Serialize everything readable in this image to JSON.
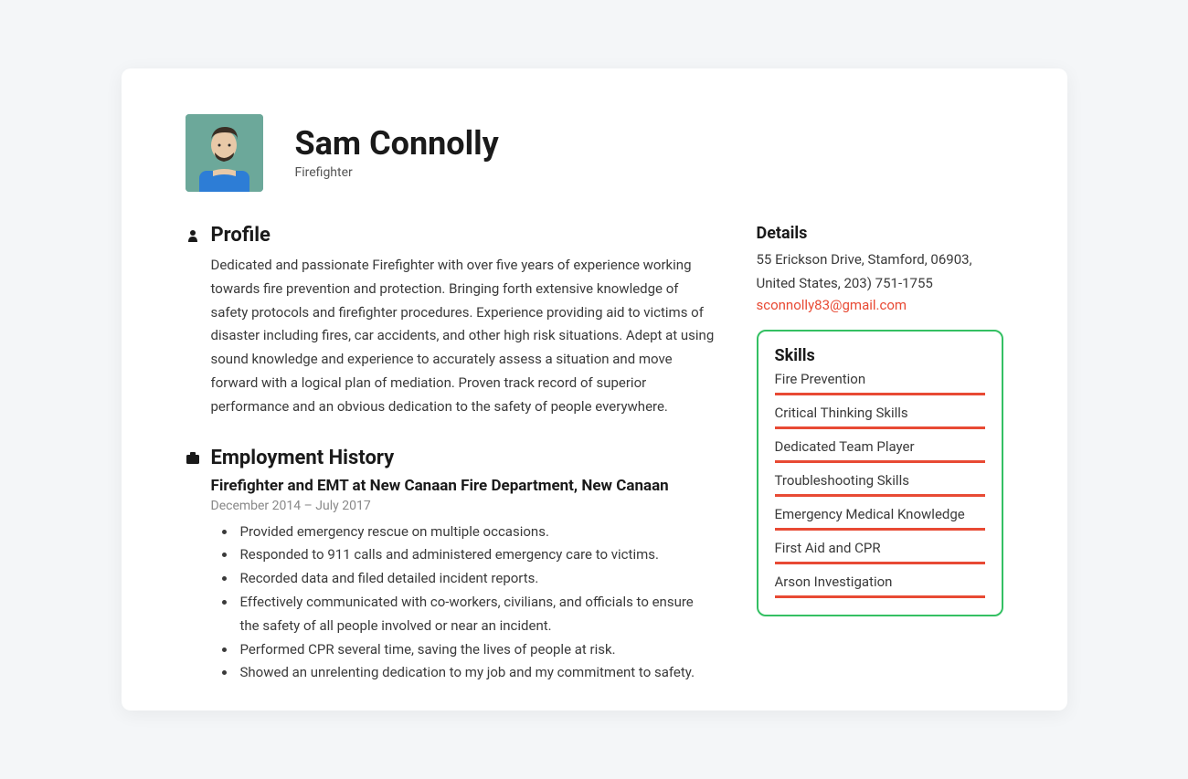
{
  "header": {
    "name": "Sam Connolly",
    "title": "Firefighter"
  },
  "profile": {
    "heading": "Profile",
    "text": "Dedicated and passionate Firefighter with over five years of experience working towards fire prevention and protection. Bringing forth extensive knowledge of safety protocols and firefighter procedures. Experience providing aid to victims of disaster including fires, car accidents, and other high risk situations. Adept at using sound knowledge and experience to accurately assess a situation and move forward with a logical plan of mediation. Proven track record of superior performance and an obvious dedication to the safety of people everywhere."
  },
  "employment": {
    "heading": "Employment History",
    "job_title": "Firefighter and EMT at New Canaan Fire Department, New Canaan",
    "date_start": "December 2014",
    "date_sep": "  –  ",
    "date_end": "July 2017",
    "bullets": [
      "Provided emergency rescue on multiple occasions.",
      "Responded to 911 calls and administered emergency care to victims.",
      "Recorded data and filed detailed incident reports.",
      "Effectively communicated with co-workers, civilians, and officials to ensure the safety of all people involved or near an incident.",
      "Performed CPR several time, saving the lives of people at risk.",
      "Showed an unrelenting dedication to my job and my commitment to safety."
    ]
  },
  "details": {
    "heading": "Details",
    "address": "55 Erickson Drive, Stamford, 06903, United States, 203) 751-1755",
    "email": "sconnolly83@gmail.com"
  },
  "skills": {
    "heading": "Skills",
    "items": [
      "Fire Prevention",
      "Critical Thinking Skills",
      "Dedicated Team Player",
      "Troubleshooting Skills",
      "Emergency Medical Knowledge",
      "First Aid and CPR",
      "Arson Investigation"
    ]
  }
}
